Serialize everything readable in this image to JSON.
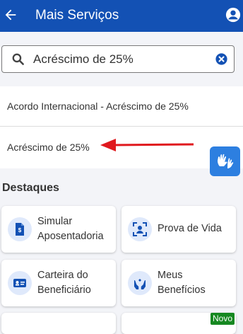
{
  "header": {
    "title": "Mais Serviços"
  },
  "search": {
    "value": "Acréscimo de 25%"
  },
  "suggestions": [
    {
      "label": "Acordo Internacional - Acréscimo de 25%"
    },
    {
      "label": "Acréscimo de 25%"
    }
  ],
  "annotation": {
    "arrow_color": "#e0191e"
  },
  "section": {
    "title": "Destaques"
  },
  "cards": [
    {
      "line1": "Simular",
      "line2": "Aposentadoria",
      "icon": "document-dollar-icon"
    },
    {
      "line1": "Prova de Vida",
      "line2": "",
      "icon": "face-scan-icon"
    },
    {
      "line1": "Carteira do",
      "line2": "Beneficiário",
      "icon": "id-card-icon"
    },
    {
      "line1": "Meus",
      "line2": "Benefícios",
      "icon": "hands-icon"
    }
  ],
  "badge": {
    "label": "Novo"
  },
  "colors": {
    "brand": "#1351b4",
    "accessibility_button": "#2d7fe0",
    "badge": "#168821"
  }
}
